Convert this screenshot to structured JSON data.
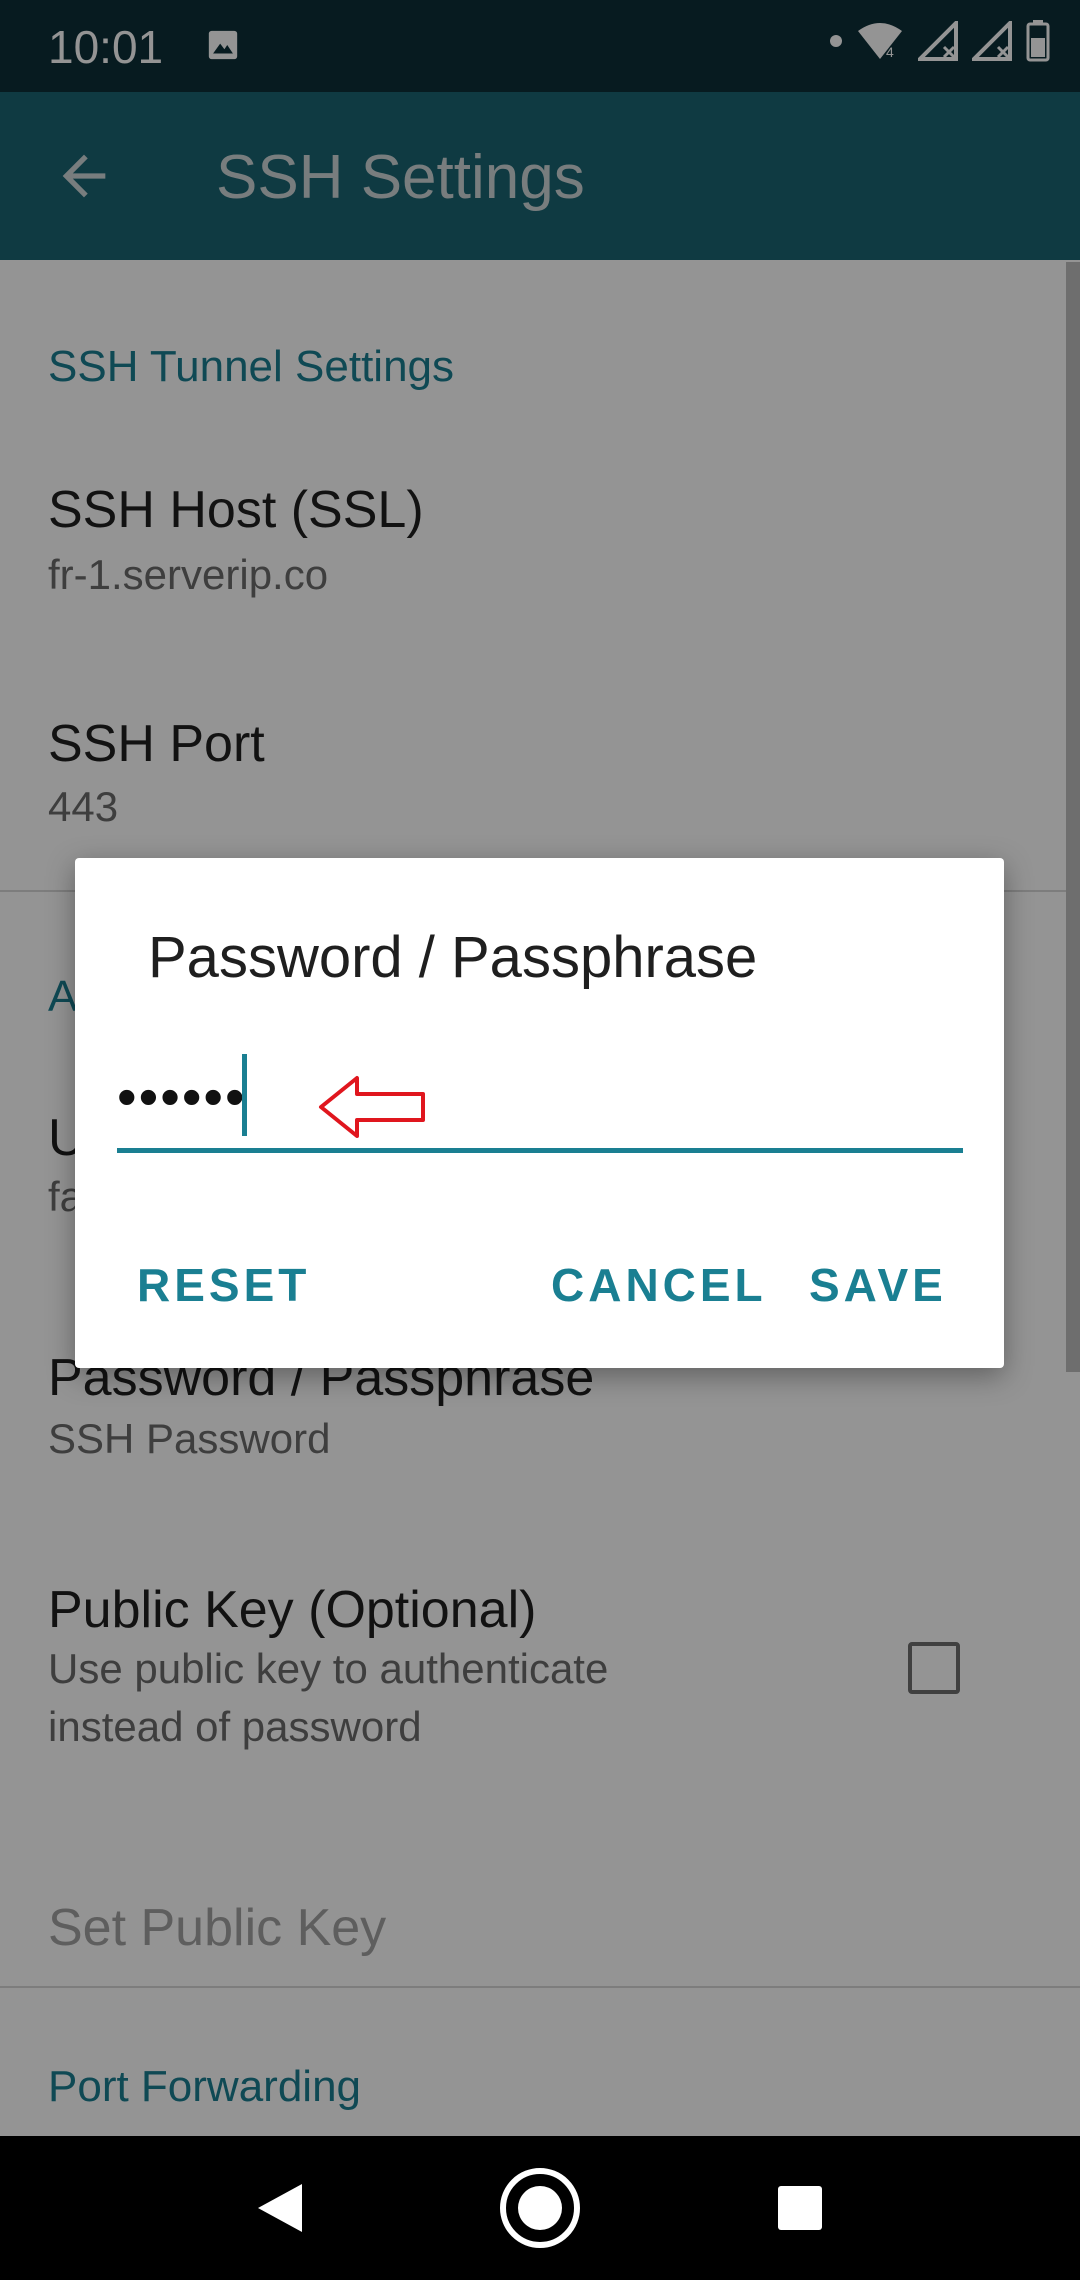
{
  "status_bar": {
    "time": "10:01",
    "wifi_label": "4"
  },
  "app_bar": {
    "title": "SSH Settings"
  },
  "settings": {
    "section_tunnel": "SSH Tunnel Settings",
    "host_title": "SSH Host (SSL)",
    "host_value": "fr-1.serverip.co",
    "port_title": "SSH Port",
    "port_value": "443",
    "section_auth_partial": "A",
    "username_title_partial": "U",
    "username_value_partial": "fa",
    "password_title": "Password / Passphrase",
    "password_sub": "SSH Password",
    "pubkey_title": "Public Key (Optional)",
    "pubkey_sub_line1": "Use public key to authenticate",
    "pubkey_sub_line2": "instead of password",
    "set_pubkey": "Set Public Key",
    "section_port_forwarding": "Port Forwarding"
  },
  "dialog": {
    "title": "Password / Passphrase",
    "input_value": "••••••",
    "reset_label": "RESET",
    "cancel_label": "CANCEL",
    "save_label": "SAVE"
  },
  "colors": {
    "accent": "#1a7f92",
    "app_bar": "#1a6472",
    "status_bar": "#0d2f38",
    "annotation_arrow": "#e0161e"
  }
}
